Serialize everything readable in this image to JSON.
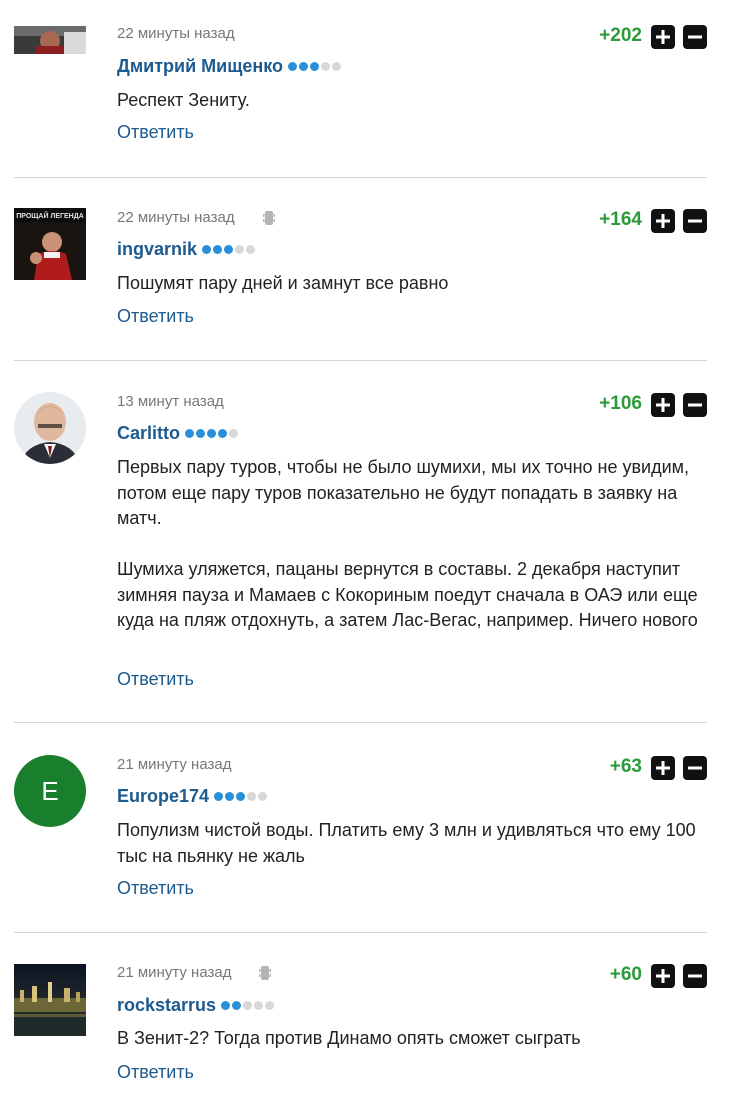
{
  "comments": [
    {
      "time": "22 минуты назад",
      "author": "Дмитрий Мищенко",
      "rating_dots_filled": 3,
      "text": [
        "Респект Зениту."
      ],
      "reply": "Ответить",
      "score": "+202",
      "mobile": false
    },
    {
      "time": "22 минуты назад",
      "author": "ingvarnik",
      "rating_dots_filled": 3,
      "text": [
        "Пошумят пару дней и замнут все равно"
      ],
      "reply": "Ответить",
      "score": "+164",
      "mobile": true,
      "avatar_caption": "ПРОЩАЙ ЛЕГЕНДА"
    },
    {
      "time": "13 минут назад",
      "author": "Carlitto",
      "rating_dots_filled": 4,
      "text": [
        "Первых пару туров, чтобы не было шумихи, мы их точно не увидим, потом еще пару туров показательно не будут попадать в заявку на матч.",
        "Шумиха уляжется, пацаны вернутся в составы. 2 декабря наступит зимняя пауза и Мамаев с Кокориным поедут сначала в ОАЭ или еще куда на пляж отдохнуть, а затем Лас-Вегас, например. Ничего нового"
      ],
      "reply": "Ответить",
      "score": "+106",
      "mobile": false
    },
    {
      "time": "21 минуту назад",
      "author": "Europe174",
      "rating_dots_filled": 3,
      "text": [
        "Популизм чистой воды. Платить ему 3 млн и удивляться что ему 100 тыс на пьянку не жаль"
      ],
      "reply": "Ответить",
      "score": "+63",
      "mobile": false,
      "avatar_letter": "E"
    },
    {
      "time": "21 минуту назад",
      "author": "rockstarrus",
      "rating_dots_filled": 2,
      "text": [
        "В Зенит-2? Тогда против Динамо опять сможет сыграть"
      ],
      "reply": "Ответить",
      "score": "+60",
      "mobile": true
    }
  ],
  "colors": {
    "author": "#1d5a8e",
    "score": "#2c9a3a",
    "dot_on": "#2a8fd9",
    "dot_off": "#d8d8d8",
    "avatar_letter_bg": "#1a7f2c"
  },
  "icons": {
    "vote_up": "plus-icon",
    "vote_down": "minus-icon",
    "mobile": "mobile-phone-icon"
  }
}
